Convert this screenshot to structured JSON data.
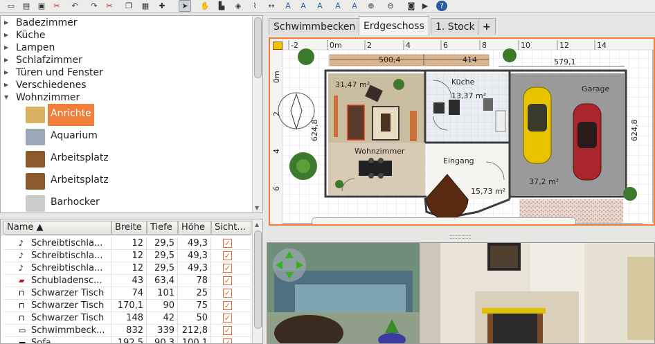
{
  "toolbar": {
    "icons": [
      "new-icon",
      "open-icon",
      "save-icon",
      "cut-tools-icon",
      "undo-icon",
      "redo-icon",
      "cut-icon",
      "copy-icon",
      "paste-icon",
      "add-furniture-icon",
      "select-icon",
      "pan-icon",
      "create-walls-icon",
      "create-rooms-icon",
      "create-polylines-icon",
      "create-dimensions-icon",
      "add-text-icon",
      "increase-text-icon",
      "decrease-text-icon",
      "bold-text-icon",
      "italic-text-icon",
      "zoom-in-icon",
      "zoom-out-icon",
      "photo-icon",
      "video-icon",
      "help-icon"
    ],
    "text_tool_label": "A"
  },
  "catalog": {
    "categories": [
      {
        "label": "Badezimmer",
        "expanded": false
      },
      {
        "label": "Küche",
        "expanded": false
      },
      {
        "label": "Lampen",
        "expanded": false
      },
      {
        "label": "Schlafzimmer",
        "expanded": false
      },
      {
        "label": "Türen und Fenster",
        "expanded": false
      },
      {
        "label": "Verschiedenes",
        "expanded": false
      },
      {
        "label": "Wohnzimmer",
        "expanded": true
      }
    ],
    "items": [
      {
        "label": "Anrichte",
        "selected": true
      },
      {
        "label": "Aquarium",
        "selected": false
      },
      {
        "label": "Arbeitsplatz",
        "selected": false
      },
      {
        "label": "Arbeitsplatz",
        "selected": false
      },
      {
        "label": "Barhocker",
        "selected": false
      }
    ]
  },
  "furniture_table": {
    "columns": [
      "Name ▲",
      "Breite",
      "Tiefe",
      "Höhe",
      "Sicht..."
    ],
    "rows": [
      {
        "icon": "lamp-icon",
        "name": "Schreibtischla...",
        "width": "12",
        "depth": "29,5",
        "height": "49,3",
        "visible": true
      },
      {
        "icon": "lamp-icon",
        "name": "Schreibtischla...",
        "width": "12",
        "depth": "29,5",
        "height": "49,3",
        "visible": true
      },
      {
        "icon": "lamp-icon",
        "name": "Schreibtischla...",
        "width": "12",
        "depth": "29,5",
        "height": "49,3",
        "visible": true
      },
      {
        "icon": "drawer-icon",
        "name": "Schubladensc...",
        "width": "43",
        "depth": "63,4",
        "height": "78",
        "visible": true
      },
      {
        "icon": "table-icon",
        "name": "Schwarzer Tisch",
        "width": "74",
        "depth": "101",
        "height": "25",
        "visible": true
      },
      {
        "icon": "table-icon",
        "name": "Schwarzer Tisch",
        "width": "170,1",
        "depth": "90",
        "height": "75",
        "visible": true
      },
      {
        "icon": "table-icon",
        "name": "Schwarzer Tisch",
        "width": "148",
        "depth": "42",
        "height": "50",
        "visible": true
      },
      {
        "icon": "pool-icon",
        "name": "Schwimmbeck...",
        "width": "832",
        "depth": "339",
        "height": "212,8",
        "visible": true
      },
      {
        "icon": "sofa-icon",
        "name": "Sofa",
        "width": "192,5",
        "depth": "90,3",
        "height": "100,1",
        "visible": true
      }
    ]
  },
  "levels": {
    "tabs": [
      "Schwimmbecken",
      "Erdgeschoss",
      "1. Stock"
    ],
    "active": "Erdgeschoss",
    "add_label": "+"
  },
  "plan": {
    "ruler_top": [
      "-2",
      "0m",
      "2",
      "4",
      "6",
      "8",
      "10",
      "12",
      "14"
    ],
    "ruler_left": [
      "0m",
      "2",
      "4",
      "6"
    ],
    "dimensions": [
      "500,4",
      "414",
      "579,1",
      "624,8",
      "624,8"
    ],
    "rooms": [
      {
        "name": "",
        "area": "31,47 m²"
      },
      {
        "name": "Küche",
        "area": "13,37 m²"
      },
      {
        "name": "Garage",
        "area": "37,2 m²"
      },
      {
        "name": "Wohnzimmer",
        "area": ""
      },
      {
        "name": "Eingang",
        "area": "15,73 m²"
      }
    ]
  },
  "colors": {
    "accent": "#f07f3c",
    "selection": "#f07f3c",
    "wall": "#3c3c3c",
    "room_floor": "#d8cab4",
    "garage_floor": "#9a9a9a",
    "car_yellow": "#e8c400",
    "car_red": "#a8262c"
  }
}
